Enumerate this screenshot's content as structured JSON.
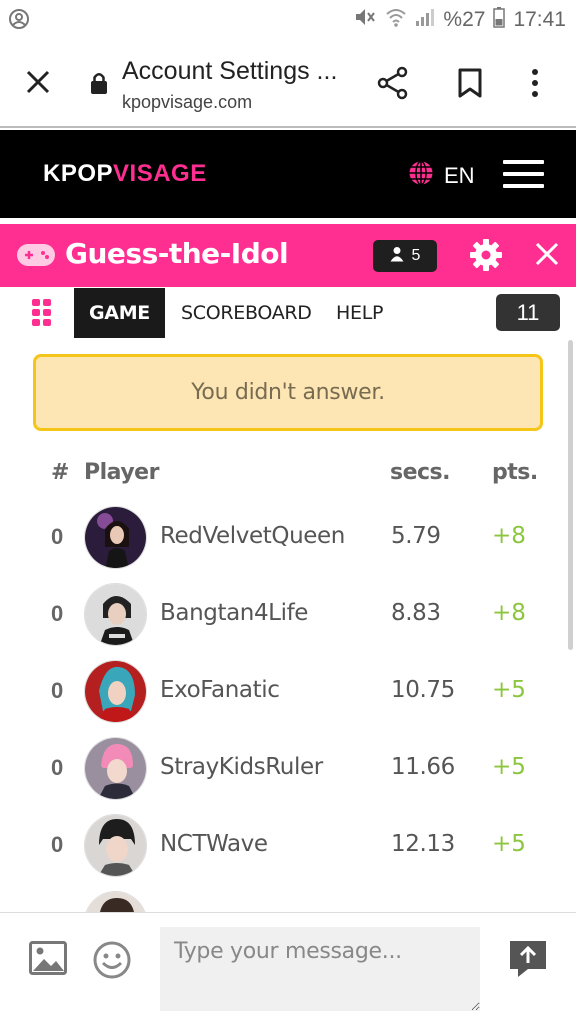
{
  "status_bar": {
    "battery": "%27",
    "time": "17:41"
  },
  "browser": {
    "page_title": "Account Settings ...",
    "url": "kpopvisage.com"
  },
  "site": {
    "logo_part1": "KPOP",
    "logo_part2": "VISAGE",
    "language": "EN"
  },
  "game": {
    "title": "Guess-the-Idol",
    "player_count": "5"
  },
  "tabs": {
    "game": "GAME",
    "scoreboard": "SCOREBOARD",
    "help": "HELP",
    "timer": "11"
  },
  "banner": {
    "message": "You didn't answer."
  },
  "scoreboard": {
    "headers": {
      "rank": "#",
      "player": "Player",
      "secs": "secs.",
      "pts": "pts."
    },
    "rows": [
      {
        "rank": "0",
        "player": "RedVelvetQueen",
        "secs": "5.79",
        "pts": "+8"
      },
      {
        "rank": "0",
        "player": "Bangtan4Life",
        "secs": "8.83",
        "pts": "+8"
      },
      {
        "rank": "0",
        "player": "ExoFanatic",
        "secs": "10.75",
        "pts": "+5"
      },
      {
        "rank": "0",
        "player": "StrayKidsRuler",
        "secs": "11.66",
        "pts": "+5"
      },
      {
        "rank": "0",
        "player": "NCTWave",
        "secs": "12.13",
        "pts": "+5"
      }
    ]
  },
  "chat": {
    "placeholder": "Type your message..."
  },
  "colors": {
    "brand_pink": "#ff2f92",
    "points_green": "#8cc63f",
    "banner_bg": "#fde6b3",
    "banner_border": "#f5c518"
  }
}
